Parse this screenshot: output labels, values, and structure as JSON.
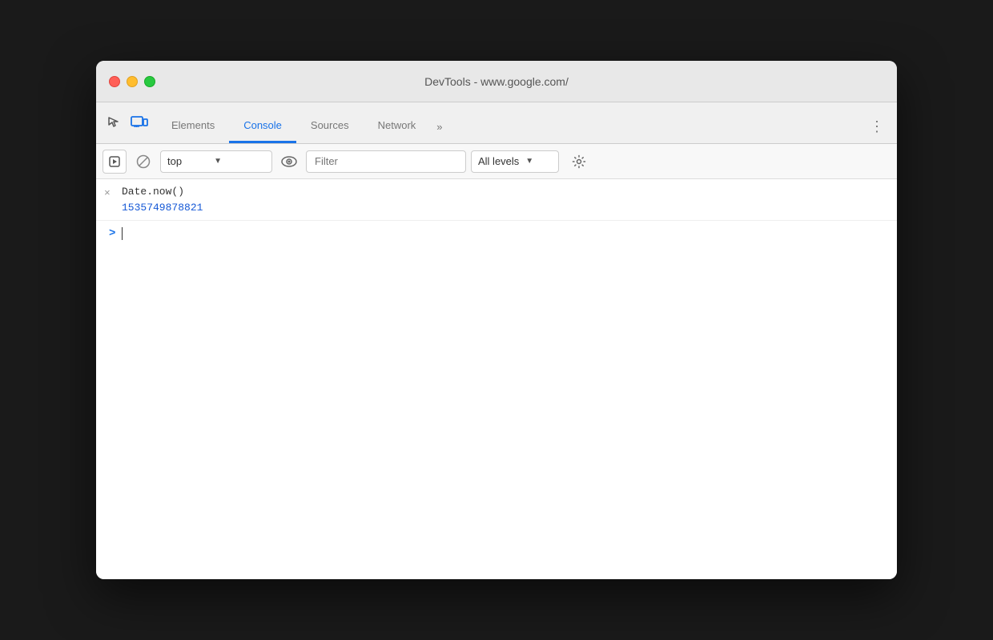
{
  "window": {
    "title": "DevTools - www.google.com/",
    "traffic_lights": {
      "close": "close",
      "minimize": "minimize",
      "maximize": "maximize"
    }
  },
  "tabs": {
    "items": [
      {
        "id": "elements",
        "label": "Elements",
        "active": false
      },
      {
        "id": "console",
        "label": "Console",
        "active": true
      },
      {
        "id": "sources",
        "label": "Sources",
        "active": false
      },
      {
        "id": "network",
        "label": "Network",
        "active": false
      }
    ],
    "more_label": "»",
    "menu_label": "⋮"
  },
  "toolbar": {
    "execute_label": "▶",
    "clear_label": "🚫",
    "context_value": "top",
    "context_arrow": "▼",
    "filter_placeholder": "Filter",
    "levels_label": "All levels",
    "levels_arrow": "▼",
    "gear_icon": "⚙"
  },
  "console": {
    "entry": {
      "icon": "×",
      "input": "Date.now()",
      "output": "1535749878821"
    },
    "prompt_arrow": ">"
  }
}
